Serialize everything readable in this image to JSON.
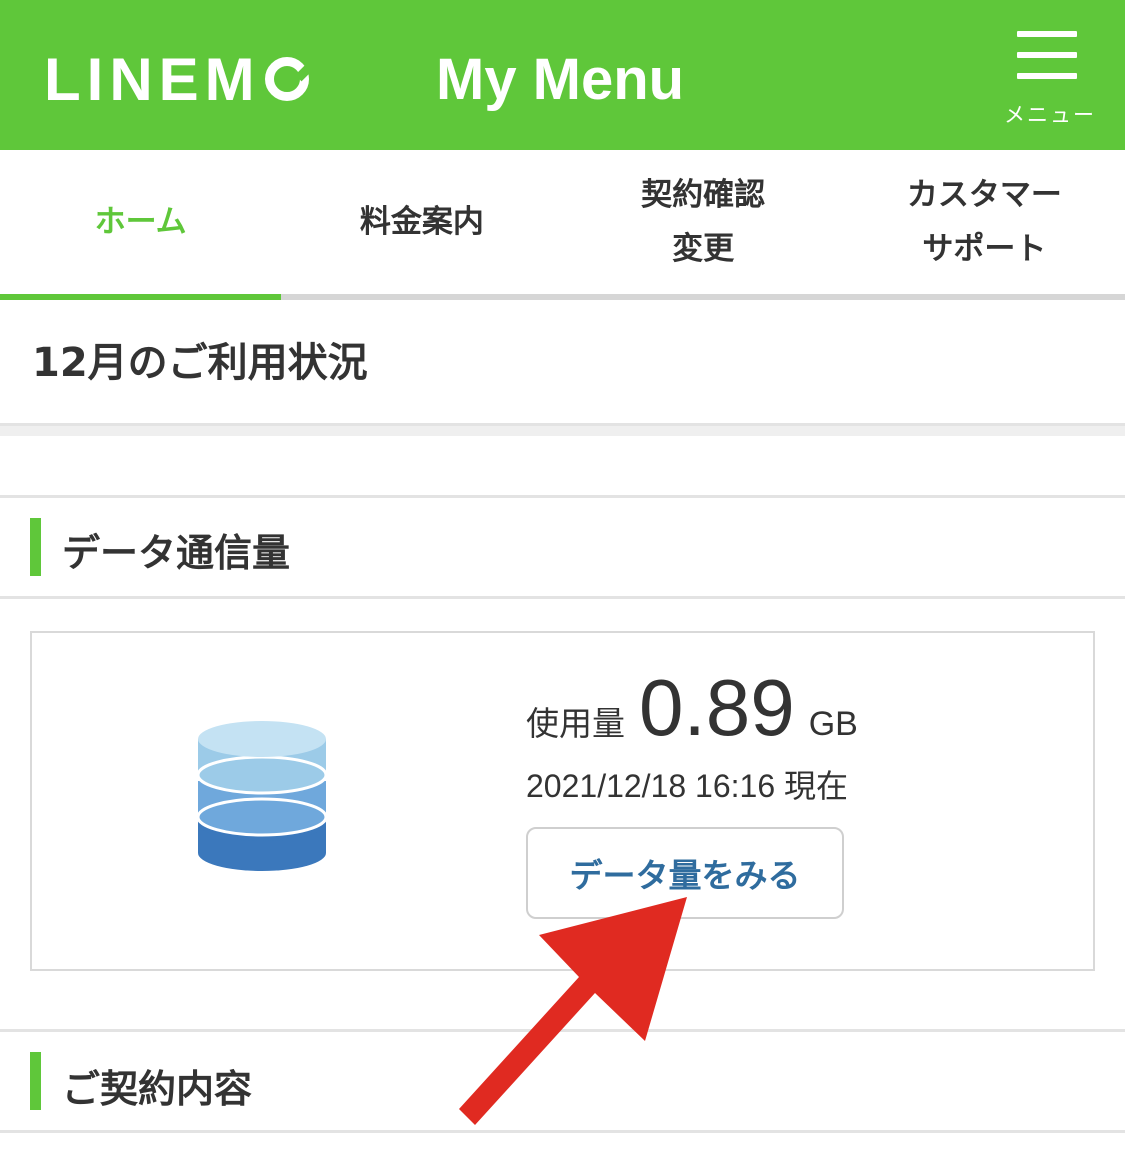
{
  "header": {
    "logo_text": "LINEM",
    "title": "My Menu",
    "menu_label": "メニュー"
  },
  "tabs": [
    {
      "label": "ホーム",
      "active": true
    },
    {
      "label": "料金案内",
      "active": false
    },
    {
      "label": "契約確認\n変更",
      "active": false
    },
    {
      "label": "カスタマー\nサポート",
      "active": false
    }
  ],
  "month_title": "12月のご利用状況",
  "data_section": {
    "title": "データ通信量",
    "usage_label": "使用量",
    "usage_value": "0.89",
    "usage_unit": "GB",
    "timestamp": "2021/12/18 16:16",
    "timestamp_suffix": "現在",
    "button_label": "データ量をみる"
  },
  "contract_section": {
    "title": "ご契約内容"
  },
  "colors": {
    "brand_green": "#5fc73a",
    "link_blue": "#2f6c9e",
    "arrow_red": "#e02a21"
  },
  "icons": [
    "hamburger-icon",
    "database-icon",
    "red-arrow-annotation"
  ]
}
